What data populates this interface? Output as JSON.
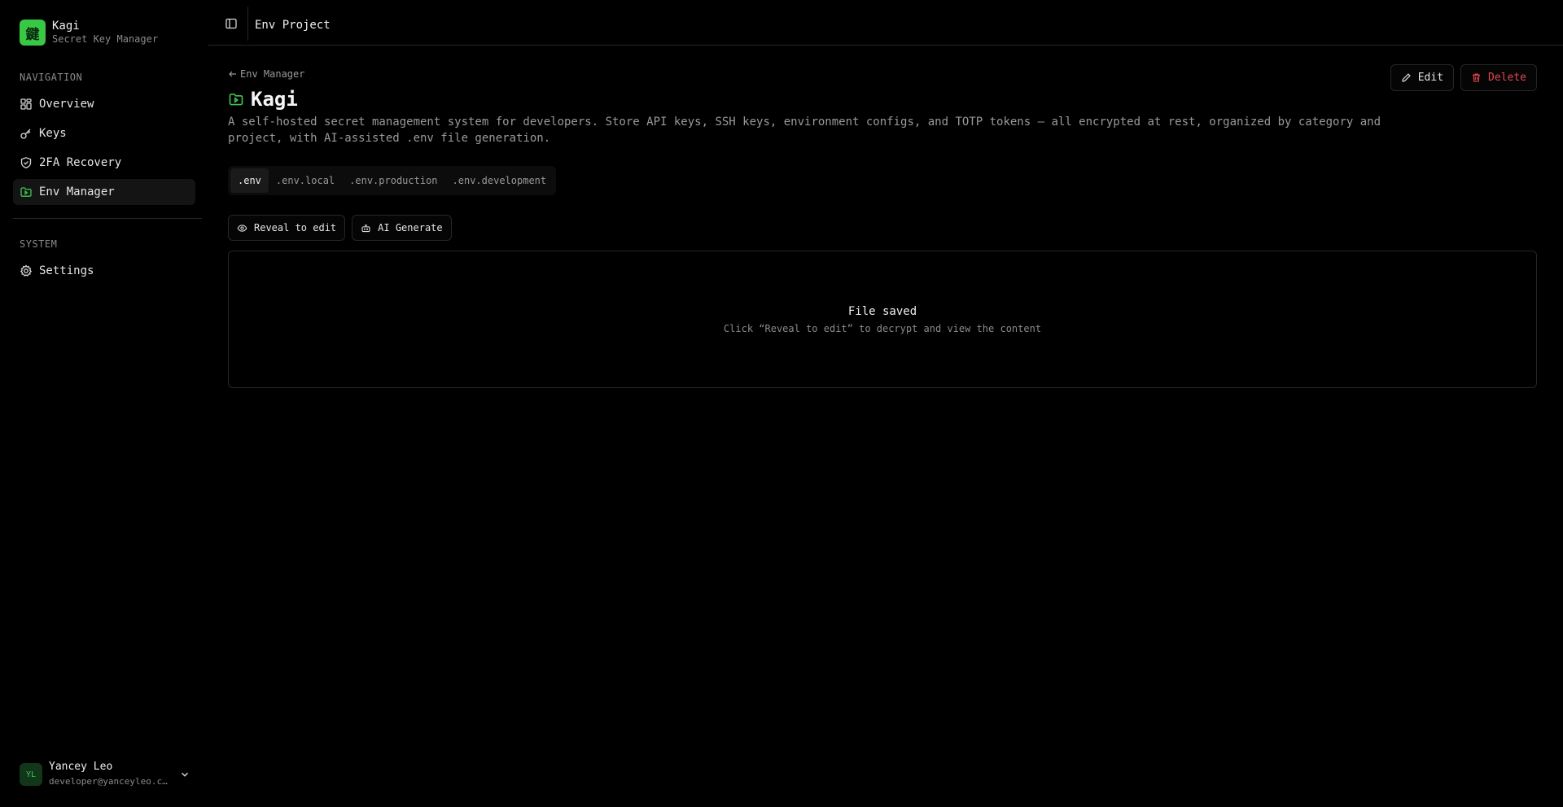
{
  "brand": {
    "logo_glyph": "鍵",
    "name": "Kagi",
    "subtitle": "Secret Key Manager",
    "accent": "#39c845"
  },
  "sidebar": {
    "navigation_label": "NAVIGATION",
    "nav_items": [
      {
        "label": "Overview",
        "icon": "grid-icon"
      },
      {
        "label": "Keys",
        "icon": "key-icon"
      },
      {
        "label": "2FA Recovery",
        "icon": "shield-check-icon"
      },
      {
        "label": "Env Manager",
        "icon": "folder-icon",
        "active": true
      }
    ],
    "system_label": "SYSTEM",
    "system_items": [
      {
        "label": "Settings",
        "icon": "gear-icon"
      }
    ]
  },
  "user": {
    "initials": "YL",
    "name": "Yancey Leo",
    "email": "developer@yanceyleo.com"
  },
  "topbar": {
    "title": "Env Project"
  },
  "page": {
    "back_label": "Env Manager",
    "title": "Kagi",
    "description": "A self-hosted secret management system for developers. Store API keys, SSH keys, environment configs, and TOTP tokens — all encrypted at rest, organized by category and project, with AI-assisted .env file generation.",
    "edit_label": "Edit",
    "delete_label": "Delete",
    "danger_color": "#e5484d"
  },
  "tabs": [
    {
      "label": ".env",
      "active": true
    },
    {
      "label": ".env.local"
    },
    {
      "label": ".env.production"
    },
    {
      "label": ".env.development"
    }
  ],
  "actions": {
    "reveal_label": "Reveal to edit",
    "ai_label": "AI Generate"
  },
  "file_panel": {
    "title": "File saved",
    "subtitle": "Click “Reveal to edit” to decrypt and view the content"
  }
}
